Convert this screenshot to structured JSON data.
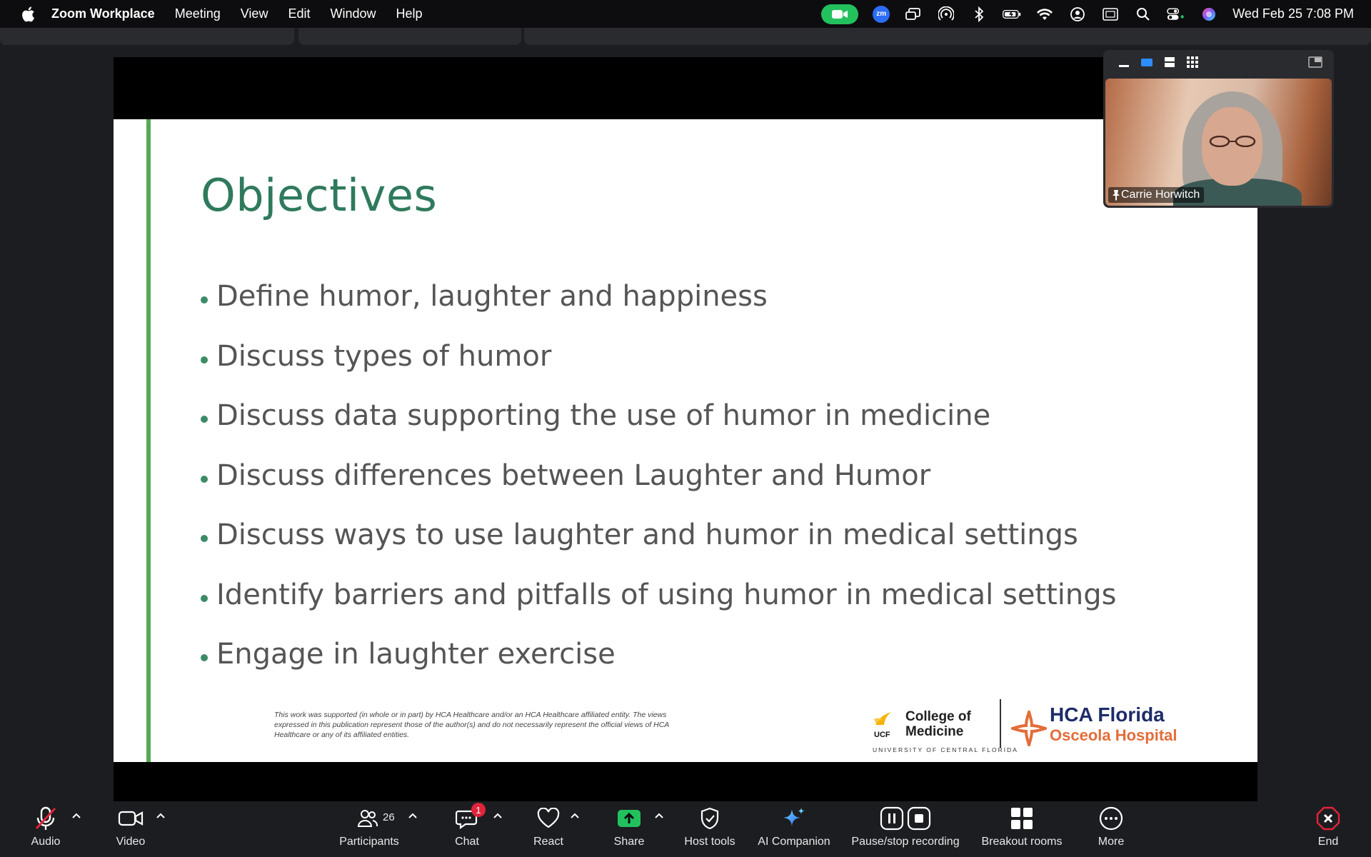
{
  "menubar": {
    "app_name": "Zoom Workplace",
    "items": [
      "Meeting",
      "View",
      "Edit",
      "Window",
      "Help"
    ],
    "zoom_badge": "zm",
    "clock": "Wed Feb 25  7:08 PM"
  },
  "slide": {
    "title": "Objectives",
    "bullets": [
      "Define humor, laughter and happiness",
      "Discuss types of humor",
      "Discuss data supporting the use of humor in medicine",
      "Discuss differences between Laughter and Humor",
      "Discuss ways to use laughter and humor in medical settings",
      "Identify barriers and pitfalls of using humor in medical settings",
      "Engage in laughter exercise"
    ],
    "disclaimer": "This work was supported (in whole or in part) by HCA Healthcare and/or an HCA Healthcare affiliated entity.  The views expressed in this publication represent those of the author(s) and do not necessarily represent the official views of HCA Healthcare or any of its affiliated entities.",
    "ucf_abbr": "UCF",
    "ucf_college_line1": "College of",
    "ucf_college_line2": "Medicine",
    "ucf_university": "UNIVERSITY OF CENTRAL FLORIDA",
    "hca_name": "HCA Florida",
    "hca_sub": "Osceola Hospital",
    "colors": {
      "title": "#2f7a5c",
      "bar": "#5aa954",
      "hca_blue": "#1d2c6a",
      "hca_orange": "#e36d3a"
    }
  },
  "video": {
    "participant_name": "Carrie Horwitch"
  },
  "toolbar": {
    "audio": "Audio",
    "video": "Video",
    "participants": "Participants",
    "participants_count": "26",
    "chat": "Chat",
    "chat_badge": "1",
    "react": "React",
    "share": "Share",
    "host_tools": "Host tools",
    "ai_companion": "AI Companion",
    "recording": "Pause/stop recording",
    "breakout": "Breakout rooms",
    "more": "More",
    "end": "End",
    "colors": {
      "share": "#22c15e",
      "end": "#e0243a",
      "mute": "#e0243a"
    }
  }
}
